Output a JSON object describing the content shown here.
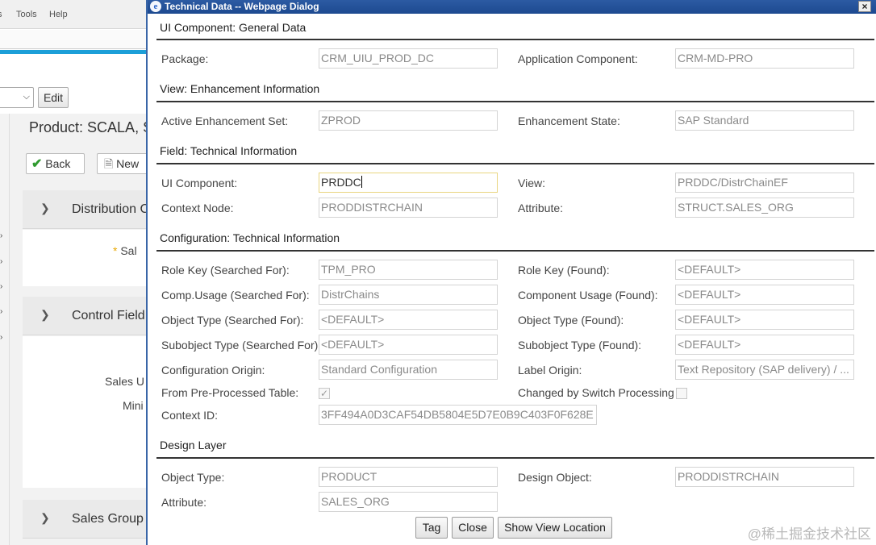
{
  "background": {
    "menu": {
      "tools": "Tools",
      "help": "Help"
    },
    "edit_label": "Edit",
    "product_title": "Product: SCALA, S",
    "back_label": "Back",
    "new_label": "New",
    "sections": [
      "Distribution C",
      "Control Field",
      "Sales Group"
    ],
    "labels": {
      "sal": "Sal",
      "sales_u": "Sales U",
      "mini": "Mini"
    }
  },
  "dialog": {
    "title": "Technical Data -- Webpage Dialog",
    "close_glyph": "×",
    "sections": {
      "general": "UI Component: General Data",
      "view": "View: Enhancement Information",
      "field": "Field: Technical Information",
      "config": "Configuration: Technical Information",
      "design": "Design Layer"
    },
    "general": {
      "package_label": "Package:",
      "package_value": "CRM_UIU_PROD_DC",
      "appcomp_label": "Application Component:",
      "appcomp_value": "CRM-MD-PRO"
    },
    "view": {
      "set_label": "Active Enhancement Set:",
      "set_value": "ZPROD",
      "state_label": "Enhancement State:",
      "state_value": "SAP Standard"
    },
    "field": {
      "uicomp_label": "UI Component:",
      "uicomp_value": "PRDDC",
      "view_label": "View:",
      "view_value": "PRDDC/DistrChainEF",
      "context_label": "Context Node:",
      "context_value": "PRODDISTRCHAIN",
      "attr_label": "Attribute:",
      "attr_value": "STRUCT.SALES_ORG"
    },
    "config": {
      "rolekey_s_label": "Role Key (Searched For):",
      "rolekey_s_value": "TPM_PRO",
      "rolekey_f_label": "Role Key (Found):",
      "rolekey_f_value": "<DEFAULT>",
      "compusage_s_label": "Comp.Usage (Searched For):",
      "compusage_s_value": "DistrChains",
      "compusage_f_label": "Component Usage (Found):",
      "compusage_f_value": "<DEFAULT>",
      "objtype_s_label": "Object Type (Searched For):",
      "objtype_s_value": "<DEFAULT>",
      "objtype_f_label": "Object Type (Found):",
      "objtype_f_value": "<DEFAULT>",
      "subobj_s_label": "Subobject Type (Searched For):",
      "subobj_s_value": "<DEFAULT>",
      "subobj_f_label": "Subobject Type (Found):",
      "subobj_f_value": "<DEFAULT>",
      "origin_label": "Configuration Origin:",
      "origin_value": "Standard Configuration",
      "labelorigin_label": "Label Origin:",
      "labelorigin_value": "Text Repository (SAP delivery) / ...",
      "preprocessed_label": "From Pre-Processed Table:",
      "preprocessed_checked": true,
      "switch_label": "Changed by Switch Processing",
      "switch_checked": false,
      "contextid_label": "Context ID:",
      "contextid_value": "3FF494A0D3CAF54DB5804E5D7E0B9C403F0F628E"
    },
    "design": {
      "objtype_label": "Object Type:",
      "objtype_value": "PRODUCT",
      "designobj_label": "Design Object:",
      "designobj_value": "PRODDISTRCHAIN",
      "attr_label": "Attribute:",
      "attr_value": "SALES_ORG"
    },
    "buttons": {
      "tag": "Tag",
      "close": "Close",
      "show_view": "Show View Location"
    },
    "check_glyph": "✓"
  },
  "watermark": "@稀土掘金技术社区"
}
